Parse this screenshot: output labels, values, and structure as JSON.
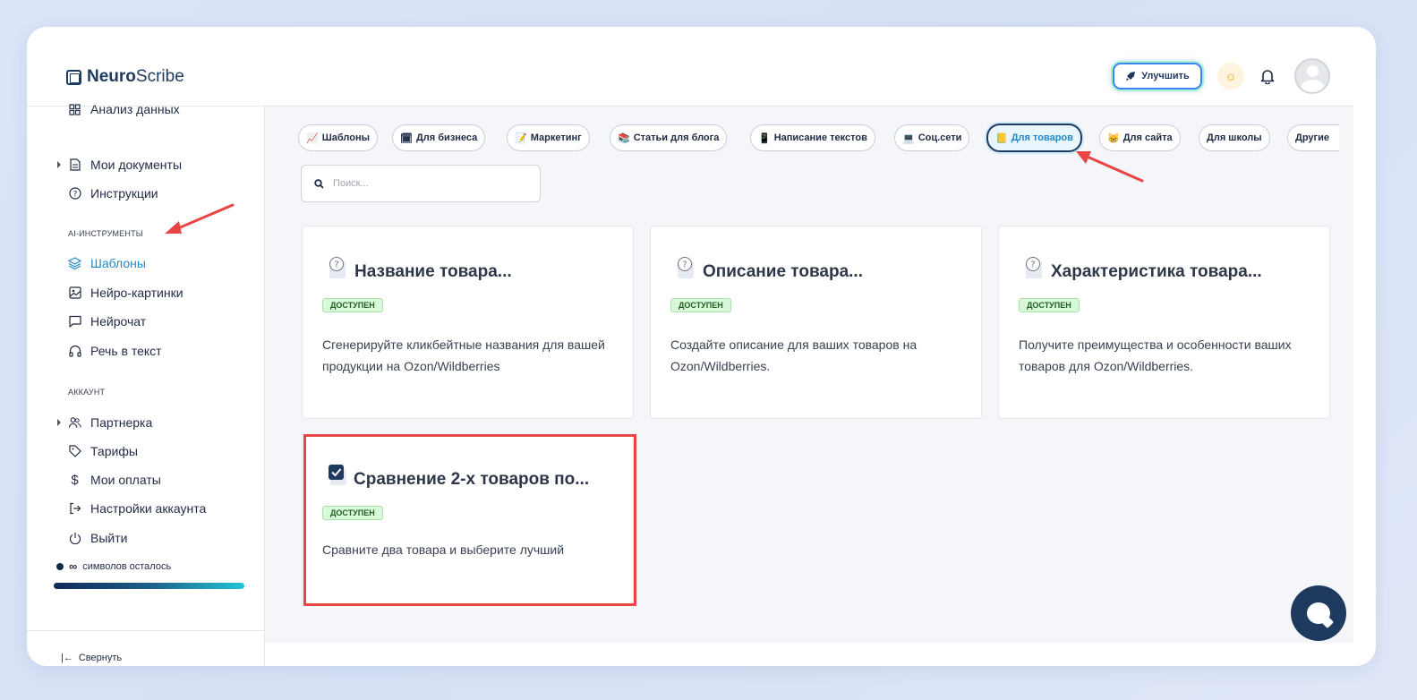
{
  "header": {
    "logo_bold": "Neuro",
    "logo_light": "Scribe",
    "upgrade_label": "Улучшить"
  },
  "sidebar": {
    "items_top": [
      {
        "label": "Анализ данных",
        "icon": "grid-icon"
      },
      {
        "label": "Мои документы",
        "icon": "document-icon"
      },
      {
        "label": "Инструкции",
        "icon": "help-circle-icon"
      }
    ],
    "section_ai": "AI-ИНСТРУМЕНТЫ",
    "items_ai": [
      {
        "label": "Шаблоны",
        "icon": "layers-icon",
        "active": true
      },
      {
        "label": "Нейро-картинки",
        "icon": "image-icon"
      },
      {
        "label": "Нейрочат",
        "icon": "chat-icon"
      },
      {
        "label": "Речь в текст",
        "icon": "headphones-icon"
      }
    ],
    "section_account": "АККАУНТ",
    "items_account": [
      {
        "label": "Партнерка",
        "icon": "users-icon"
      },
      {
        "label": "Тарифы",
        "icon": "tag-icon"
      },
      {
        "label": "Мои оплаты",
        "icon": "dollar-icon"
      },
      {
        "label": "Настройки аккаунта",
        "icon": "login-icon"
      },
      {
        "label": "Выйти",
        "icon": "power-icon"
      }
    ],
    "credits_value": "∞",
    "credits_label": "символов осталось",
    "collapse_label": "Свернуть"
  },
  "main": {
    "chips": [
      {
        "label": "Шаблоны",
        "emoji": "📈"
      },
      {
        "label": "Для бизнеса",
        "emoji": "🗓"
      },
      {
        "label": "Маркетинг",
        "emoji": "📝"
      },
      {
        "label": "Статьи для блога",
        "emoji": "📚"
      },
      {
        "label": "Написание текстов",
        "emoji": "📱"
      },
      {
        "label": "Соц.сети",
        "emoji": "💻"
      },
      {
        "label": "Для товаров",
        "emoji": "📒",
        "active": true
      },
      {
        "label": "Для сайта",
        "emoji": "😸"
      },
      {
        "label": "Для школы",
        "emoji": ""
      },
      {
        "label": "Другие",
        "emoji": ""
      }
    ],
    "search_placeholder": "Поиск...",
    "cards": [
      {
        "title": "Название товара...",
        "badge": "ДОСТУПЕН",
        "desc": "Сгенерируйте кликбейтные названия для вашей продукции на Ozon/Wildberries",
        "icon": "question-bubble-icon"
      },
      {
        "title": "Описание товара...",
        "badge": "ДОСТУПЕН",
        "desc": "Создайте описание для ваших товаров на Ozon/Wildberries.",
        "icon": "question-bubble-icon"
      },
      {
        "title": "Характеристика товара...",
        "badge": "ДОСТУПЕН",
        "desc": "Получите преимущества и особенности ваших товаров для Ozon/Wildberries.",
        "icon": "question-bubble-icon"
      },
      {
        "title": "Сравнение 2-х товаров по...",
        "badge": "ДОСТУПЕН",
        "desc": "Сравните два товара и выберите лучший",
        "icon": "checkbox-icon"
      }
    ]
  },
  "colors": {
    "accent": "#1e88c9",
    "navy": "#1e3a5f",
    "annotation_red": "#e84545",
    "badge_bg": "#d9f7d9"
  }
}
